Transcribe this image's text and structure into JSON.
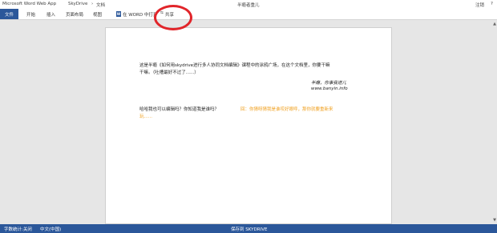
{
  "titlebar": {
    "app_name": "Microsoft Word Web App",
    "breadcrumb_root": "SkyDrive",
    "breadcrumb_sep": "›",
    "breadcrumb_leaf": "文档",
    "doc_title": "半瘾者重儿",
    "user_action": "注销",
    "help": "?"
  },
  "ribbon": {
    "file_tab": "文件",
    "tabs": [
      "开始",
      "插入",
      "页面布局",
      "视图"
    ],
    "open_in_word": "在 WORD 中打开",
    "share": "共享"
  },
  "document": {
    "paragraph_lines": [
      "这是半瘾《如何用skydrive进行多人协同文档编辑》课程中的涂鸦广场，在这个文档里，你要干嘛",
      "干嘛。（吐槽最好不过了......）"
    ],
    "signature_line1": "半瘾，你事我道儿",
    "signature_line2": "www.banyin.info",
    "question": "哈哈我也可以编辑吗？你知道我是谁吗？",
    "reply_lines": [
      "回：你猜呀猜我是谁哎好眼呼，那你就要重新来",
      "玩......"
    ]
  },
  "statusbar": {
    "word_count": "字数统计:关闭",
    "language": "中文(中国)",
    "save_status": "保存到 SKYDRIVE"
  },
  "colors": {
    "brand_blue": "#2b579a",
    "annotation_red": "#e1252a",
    "reply_orange": "#f0a020"
  }
}
